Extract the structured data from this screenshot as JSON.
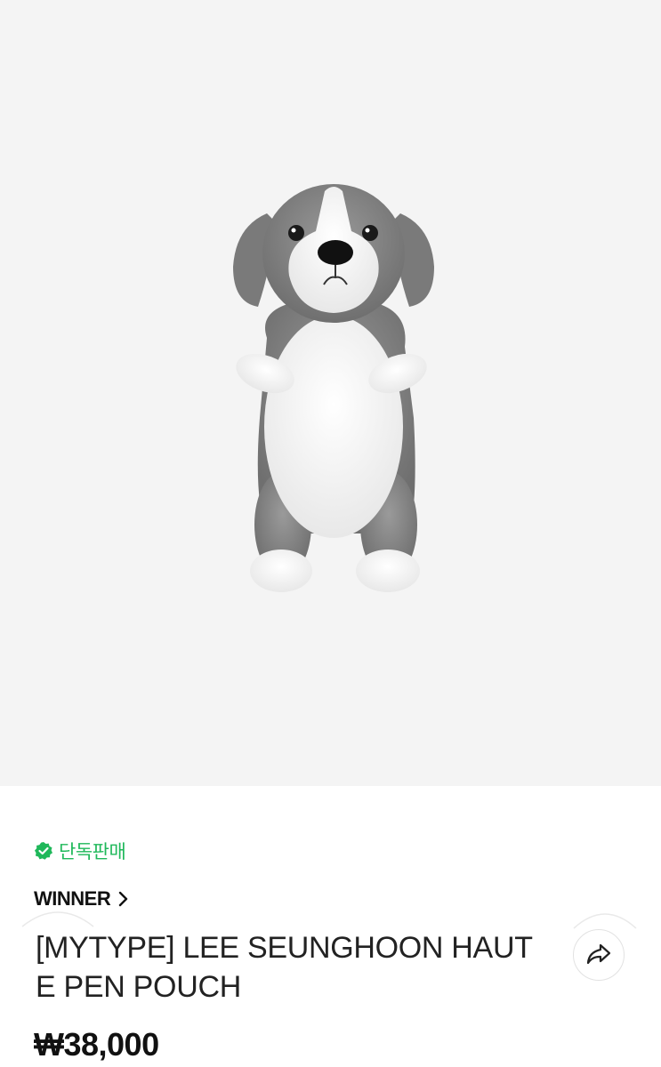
{
  "product": {
    "image_alt": "gray and white plush puppy pen pouch",
    "badge": {
      "icon": "verified-check-icon",
      "label": "단독판매",
      "color": "#1fb85a"
    },
    "artist": {
      "name": "WINNER",
      "chevron": ">"
    },
    "title": "[MYTYPE] LEE SEUNGHOON HAUTE PEN POUCH",
    "price": "₩38,000"
  },
  "actions": {
    "share_icon": "share-icon"
  }
}
